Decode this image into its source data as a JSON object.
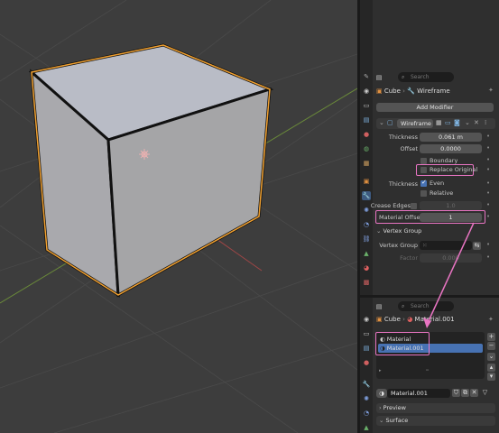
{
  "properties": {
    "search_placeholder": "Search",
    "breadcrumb": {
      "object": "Cube",
      "modifier": "Wireframe"
    },
    "add_modifier_label": "Add Modifier",
    "modifier": {
      "name": "Wireframe",
      "thickness_label": "Thickness",
      "thickness_value": "0.061 m",
      "offset_label": "Offset",
      "offset_value": "0.0000",
      "boundary_label": "Boundary",
      "replace_original_label": "Replace Original",
      "thickness2_label": "Thickness",
      "even_label": "Even",
      "relative_label": "Relative",
      "crease_edges_label": "Crease Edges",
      "crease_edges_value": "1.0",
      "material_offset_label": "Material Offset",
      "material_offset_value": "1",
      "vertex_group_section": "Vertex Group",
      "vertex_group_label": "Vertex Group",
      "factor_label": "Factor",
      "factor_value": "0.000"
    }
  },
  "material": {
    "search_placeholder": "Search",
    "breadcrumb": {
      "object": "Cube",
      "material": "Material.001"
    },
    "slots": [
      "Material",
      "Material.001"
    ],
    "selected_index": 1,
    "datablock_name": "Material.001",
    "preview_label": "Preview",
    "surface_label": "Surface"
  },
  "colors": {
    "highlight": "#e874c2",
    "selection": "#4772b3",
    "cube_outline": "#f0a030"
  },
  "icons": [
    "wrench-icon",
    "search-icon",
    "pin-icon",
    "camera-icon",
    "monitor-icon"
  ]
}
